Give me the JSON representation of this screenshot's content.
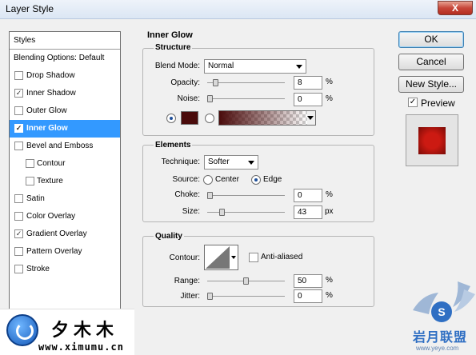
{
  "window": {
    "title": "Layer Style",
    "close_label": "X"
  },
  "styles_list": {
    "items": [
      {
        "label": "Styles",
        "checkbox": false,
        "checked": false,
        "indent": false
      },
      {
        "label": "Blending Options: Default",
        "checkbox": false,
        "checked": false,
        "indent": false
      },
      {
        "label": "Drop Shadow",
        "checkbox": true,
        "checked": false,
        "indent": false
      },
      {
        "label": "Inner Shadow",
        "checkbox": true,
        "checked": true,
        "indent": false
      },
      {
        "label": "Outer Glow",
        "checkbox": true,
        "checked": false,
        "indent": false
      },
      {
        "label": "Inner Glow",
        "checkbox": true,
        "checked": true,
        "indent": false,
        "selected": true
      },
      {
        "label": "Bevel and Emboss",
        "checkbox": true,
        "checked": false,
        "indent": false
      },
      {
        "label": "Contour",
        "checkbox": true,
        "checked": false,
        "indent": true
      },
      {
        "label": "Texture",
        "checkbox": true,
        "checked": false,
        "indent": true
      },
      {
        "label": "Satin",
        "checkbox": true,
        "checked": false,
        "indent": false
      },
      {
        "label": "Color Overlay",
        "checkbox": true,
        "checked": false,
        "indent": false
      },
      {
        "label": "Gradient Overlay",
        "checkbox": true,
        "checked": true,
        "indent": false
      },
      {
        "label": "Pattern Overlay",
        "checkbox": true,
        "checked": false,
        "indent": false
      },
      {
        "label": "Stroke",
        "checkbox": true,
        "checked": false,
        "indent": false
      }
    ],
    "check_mark": "✓"
  },
  "inner_glow": {
    "section_title": "Inner Glow",
    "structure": {
      "title": "Structure",
      "blend_mode_label": "Blend Mode:",
      "blend_mode_value": "Normal",
      "opacity_label": "Opacity:",
      "opacity_value": "8",
      "opacity_fraction": 0.08,
      "noise_label": "Noise:",
      "noise_value": "0",
      "noise_fraction": 0.0,
      "percent": "%",
      "color_swatch": "#4a0b0b",
      "gradient_color": "#4a0b0b"
    },
    "elements": {
      "title": "Elements",
      "technique_label": "Technique:",
      "technique_value": "Softer",
      "source_label": "Source:",
      "source_center": "Center",
      "source_edge": "Edge",
      "choke_label": "Choke:",
      "choke_value": "0",
      "choke_fraction": 0.0,
      "size_label": "Size:",
      "size_value": "43",
      "size_fraction": 0.17,
      "percent": "%",
      "px": "px"
    },
    "quality": {
      "title": "Quality",
      "contour_label": "Contour:",
      "anti_aliased_label": "Anti-aliased",
      "range_label": "Range:",
      "range_value": "50",
      "range_fraction": 0.5,
      "jitter_label": "Jitter:",
      "jitter_value": "0",
      "jitter_fraction": 0.0,
      "percent": "%"
    }
  },
  "buttons": {
    "ok": "OK",
    "cancel": "Cancel",
    "new_style": "New Style...",
    "preview": "Preview"
  },
  "preview_color": "#cc1a12",
  "watermarks": {
    "left_cn": "夕木木",
    "left_url": "www.ximumu.cn",
    "right_cn": "岩月联盟",
    "right_url": "www.yeye.com"
  }
}
